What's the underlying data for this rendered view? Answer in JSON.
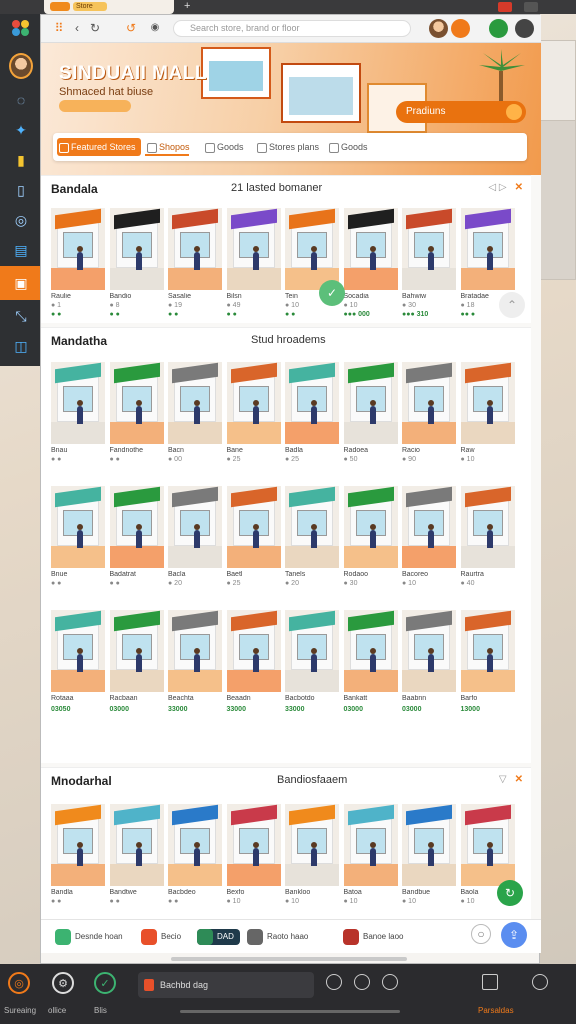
{
  "colors": {
    "accent": "#f07a1a",
    "rail": "#2e3033",
    "dock": "#2b2b2e",
    "green": "#2a9a3e"
  },
  "browser": {
    "tab_chip": "Store",
    "url_placeholder": "Search store, brand or floor",
    "icons": [
      "back-icon",
      "forward-icon",
      "reload-icon",
      "home-icon"
    ]
  },
  "hero": {
    "title": "SINDUAII MALL",
    "subtitle": "Shmaced hat biuse",
    "cta": "Pradiuns"
  },
  "tabs": [
    {
      "label": "Featured Stores"
    },
    {
      "label": "Shopos"
    },
    {
      "label": "Goods"
    },
    {
      "label": "Stores plans"
    },
    {
      "label": "Goods"
    }
  ],
  "sections": [
    {
      "title": "Bandala",
      "subtitle": "21 lasted bomaner",
      "cards": [
        {
          "label": "Raulie",
          "meta": "● 1",
          "price": "● ●"
        },
        {
          "label": "Bandio",
          "meta": "● 8",
          "price": "● ●"
        },
        {
          "label": "Sasalie",
          "meta": "● 19",
          "price": "● ●"
        },
        {
          "label": "Bilsn",
          "meta": "● 49",
          "price": "● ●"
        },
        {
          "label": "Tein",
          "meta": "● 10",
          "price": "● ●"
        },
        {
          "label": "Socadia",
          "meta": "● 10",
          "price": "●●● 000"
        },
        {
          "label": "Bahwiw",
          "meta": "● 30",
          "price": "●●● 310"
        },
        {
          "label": "Bratadae",
          "meta": "● 18",
          "price": "●● ●"
        }
      ]
    },
    {
      "title": "Mandatha",
      "subtitle": "Stud hroadems",
      "cards": [
        {
          "label": "Bnau",
          "meta": "● ●",
          "price": ""
        },
        {
          "label": "Fandnothe",
          "meta": "● ●",
          "price": ""
        },
        {
          "label": "Bacn",
          "meta": "● 00",
          "price": ""
        },
        {
          "label": "Bane",
          "meta": "● 25",
          "price": ""
        },
        {
          "label": "Badla",
          "meta": "● 25",
          "price": ""
        },
        {
          "label": "Radoea",
          "meta": "● 50",
          "price": ""
        },
        {
          "label": "Racio",
          "meta": "● 90",
          "price": ""
        },
        {
          "label": "Raw",
          "meta": "● 10",
          "price": ""
        },
        {
          "label": "Bnue",
          "meta": "● ●",
          "price": ""
        },
        {
          "label": "Badatrat",
          "meta": "● ●",
          "price": ""
        },
        {
          "label": "Bacla",
          "meta": "● 20",
          "price": ""
        },
        {
          "label": "Baetl",
          "meta": "● 25",
          "price": ""
        },
        {
          "label": "Tanels",
          "meta": "● 20",
          "price": ""
        },
        {
          "label": "Rodaoo",
          "meta": "● 30",
          "price": ""
        },
        {
          "label": "Bacoreo",
          "meta": "● 10",
          "price": ""
        },
        {
          "label": "Raurtra",
          "meta": "● 40",
          "price": ""
        },
        {
          "label": "Rotaaa",
          "meta": "",
          "price": "03050"
        },
        {
          "label": "Racbaan",
          "meta": "",
          "price": "03000"
        },
        {
          "label": "Beachta",
          "meta": "",
          "price": "33000"
        },
        {
          "label": "Beaadn",
          "meta": "",
          "price": "33000"
        },
        {
          "label": "Bacbotdo",
          "meta": "",
          "price": "33000"
        },
        {
          "label": "Bankatt",
          "meta": "",
          "price": "03000"
        },
        {
          "label": "Baabnn",
          "meta": "",
          "price": "03000"
        },
        {
          "label": "Barfo",
          "meta": "",
          "price": "13000"
        }
      ]
    },
    {
      "title": "Mnodarhal",
      "subtitle": "Bandiosfaaem",
      "cards": [
        {
          "label": "Bandla",
          "meta": "● ●",
          "price": ""
        },
        {
          "label": "Bandtwe",
          "meta": "● ●",
          "price": ""
        },
        {
          "label": "Bacbdeo",
          "meta": "● ●",
          "price": ""
        },
        {
          "label": "Bexfo",
          "meta": "● 10",
          "price": ""
        },
        {
          "label": "Bankloo",
          "meta": "● 10",
          "price": ""
        },
        {
          "label": "Batoa",
          "meta": "● 10",
          "price": ""
        },
        {
          "label": "Bandbue",
          "meta": "● 10",
          "price": ""
        },
        {
          "label": "Baola",
          "meta": "● 10",
          "price": ""
        }
      ]
    }
  ],
  "filterbar": [
    {
      "label": "Desnde hoan"
    },
    {
      "label": "Becio"
    },
    {
      "label": "DAD"
    },
    {
      "label": "Raoto haao"
    },
    {
      "label": "Banoe laoo"
    }
  ],
  "dock": {
    "left_items": [
      "Sureaing",
      "ollice",
      "Blis"
    ],
    "search_label": "Bachbd dag",
    "right_label": "Parsaldas"
  }
}
